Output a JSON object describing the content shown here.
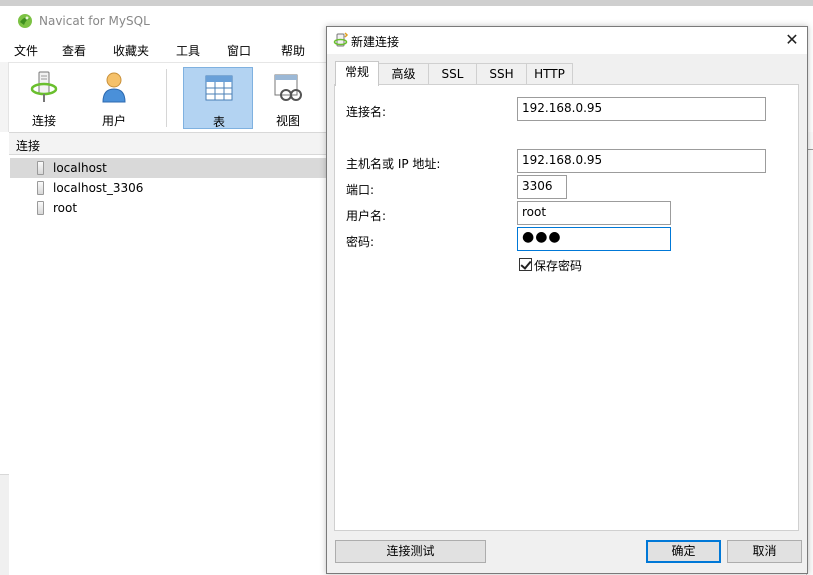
{
  "main_window": {
    "title": "Navicat for MySQL",
    "menu": [
      "文件",
      "查看",
      "收藏夹",
      "工具",
      "窗口",
      "帮助"
    ],
    "toolbar": [
      {
        "label": "连接",
        "icon": "connection-icon"
      },
      {
        "label": "用户",
        "icon": "user-icon"
      },
      {
        "label": "表",
        "icon": "table-icon",
        "active": true
      },
      {
        "label": "视图",
        "icon": "view-icon"
      }
    ],
    "connections_header": "连接",
    "connections": [
      "localhost",
      "localhost_3306",
      "root"
    ],
    "selected_connection": "localhost"
  },
  "dialog": {
    "title": "新建连接",
    "close_glyph": "✕",
    "tabs": [
      "常规",
      "高级",
      "SSL",
      "SSH",
      "HTTP"
    ],
    "active_tab": "常规",
    "fields": {
      "connection_name": {
        "label": "连接名:",
        "value": "192.168.0.95"
      },
      "host": {
        "label": "主机名或 IP 地址:",
        "value": "192.168.0.95"
      },
      "port": {
        "label": "端口:",
        "value": "3306"
      },
      "username": {
        "label": "用户名:",
        "value": "root"
      },
      "password": {
        "label": "密码:",
        "value": "●●●"
      }
    },
    "save_password": {
      "label": "保存密码",
      "checked": true
    },
    "buttons": {
      "test": "连接测试",
      "ok": "确定",
      "cancel": "取消"
    }
  },
  "colors": {
    "accent": "#0078d7",
    "active_tool_bg": "#b3d3f2",
    "selected_row_bg": "#d9d9d9",
    "dialog_bg": "#f0f0f0"
  }
}
